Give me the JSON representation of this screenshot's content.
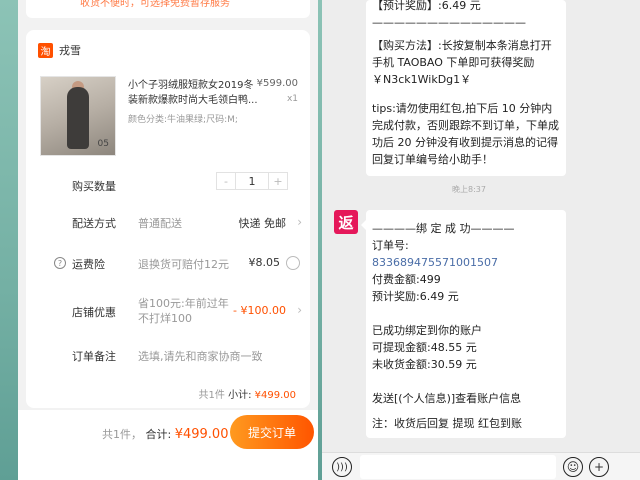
{
  "left": {
    "banner_text": "收货不便时，可选择免费暂存服务",
    "shop": {
      "logo": "淘",
      "name": "戎雪"
    },
    "product": {
      "title": "小个子羽绒服短款女2019冬装新款爆款时尚大毛领白鸭...",
      "variant": "颜色分类:牛油果绿;尺码:M;",
      "price": "¥599.00",
      "qty": "x1",
      "image_tag": "05"
    },
    "quantity": {
      "label": "购买数量",
      "minus": "-",
      "value": "1",
      "plus": "+"
    },
    "shipping": {
      "label": "配送方式",
      "mode": "普通配送",
      "value": "快递 免邮"
    },
    "insurance": {
      "label": "运费险",
      "desc": "退换货可赔付12元",
      "value": "¥8.05"
    },
    "discount": {
      "label": "店铺优惠",
      "desc": "省100元:年前过年不打烊100",
      "value": "- ¥100.00"
    },
    "note": {
      "label": "订单备注",
      "placeholder": "选填,请先和商家协商一致"
    },
    "subtotal": {
      "count": "共1件",
      "label": "小计:",
      "value": "¥499.00"
    },
    "footer": {
      "count": "共1件，",
      "label": "合计:",
      "value": "¥499.00",
      "submit": "提交订单"
    }
  },
  "right": {
    "bubble1": {
      "line_reward": "【预计奖励】:6.49 元",
      "divider": "——————————————",
      "buy_method": "【购买方法】:长按复制本条消息打开手机 TAOBAO 下单即可获得奖励￥N3ck1WikDg1￥",
      "tips": "tips:请勿使用红包,拍下后 10 分钟内完成付款，否则跟踪不到订单，下单成功后 20 分钟没有收到提示消息的记得回复订单编号给小助手！"
    },
    "timestamp": "晚上8:37",
    "avatar_text": "返",
    "bubble2": {
      "title": "————绑 定 成 功————",
      "order_label": "订单号:",
      "order_no": "833689475571001507",
      "paid": "付费金额:499",
      "reward": "预计奖励:6.49 元",
      "bound": "已成功绑定到你的账户",
      "withdrawable": "可提现金额:48.55 元",
      "pending": "未收货金额:30.59 元",
      "send_info": "发送[(个人信息)]查看账户信息",
      "note": "注：收货后回复  提现  红包到账"
    }
  }
}
